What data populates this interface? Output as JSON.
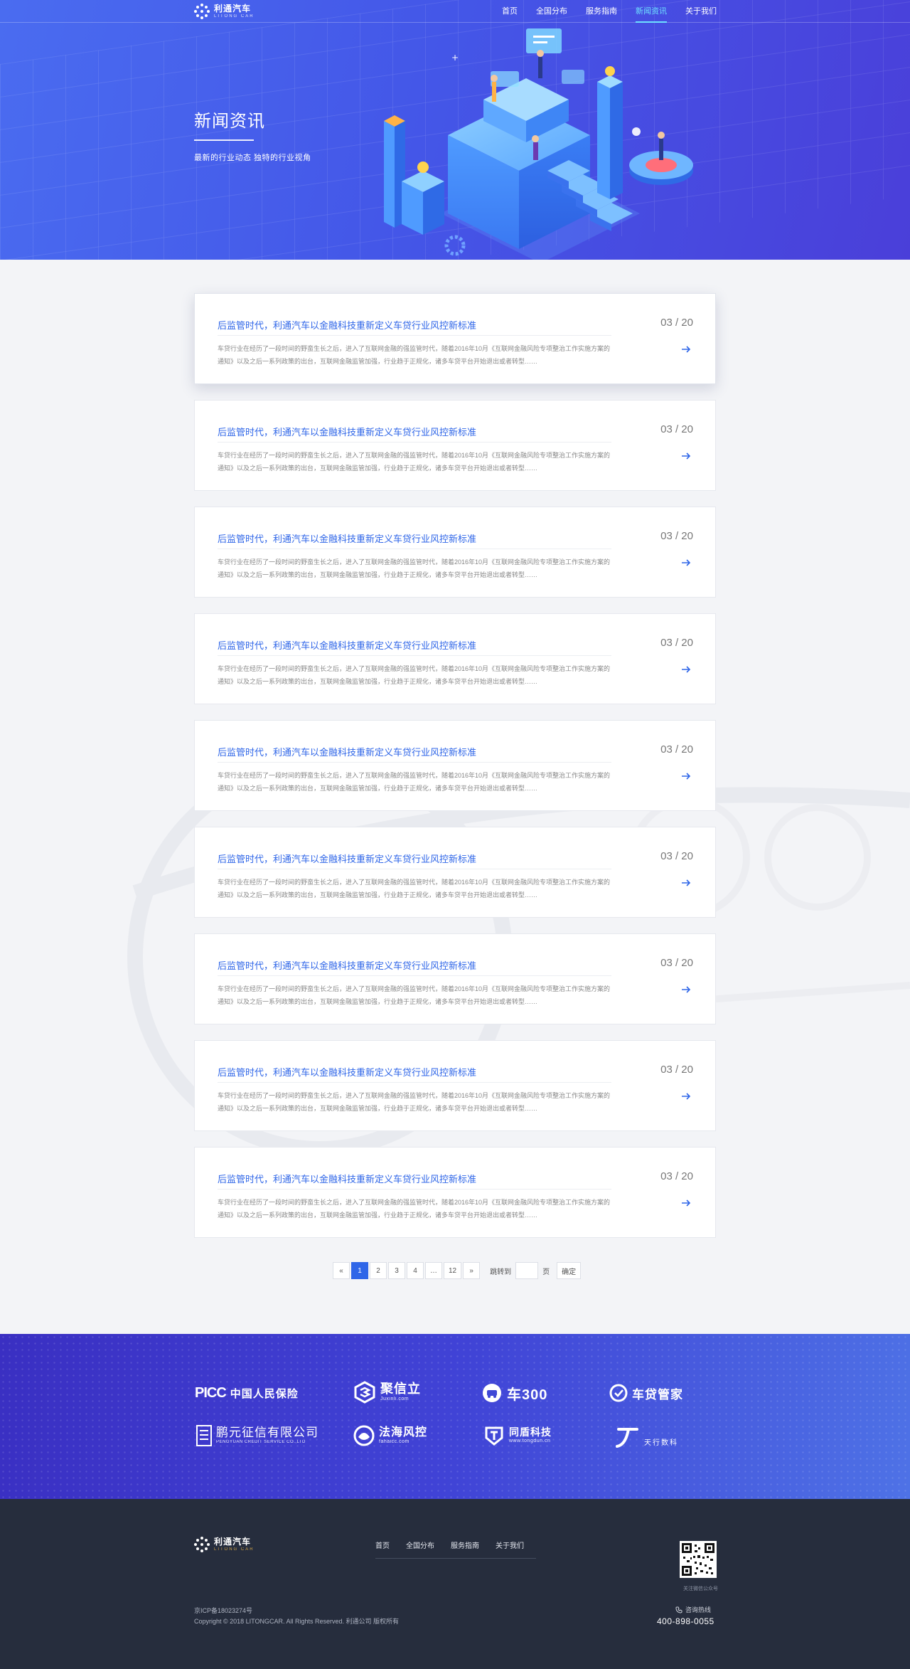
{
  "nav": {
    "logo_cn": "利通汽车",
    "logo_en": "LITONG CAR",
    "items": [
      {
        "label": "首页",
        "active": false
      },
      {
        "label": "全国分布",
        "active": false
      },
      {
        "label": "服务指南",
        "active": false
      },
      {
        "label": "新闻资讯",
        "active": true
      },
      {
        "label": "关于我们",
        "active": false
      }
    ]
  },
  "hero": {
    "title": "新闻资讯",
    "subtitle": "最新的行业动态  独特的行业视角"
  },
  "news": [
    {
      "title": "后监管时代，利通汽车以金融科技重新定义车贷行业风控新标准",
      "date": "03 / 20",
      "desc": "车贷行业在经历了一段时间的野蛮生长之后，进入了互联网金融的强监管时代，随着2016年10月《互联网金融风险专项整治工作实施方案的通知》以及之后一系列政策的出台，互联网金融监管加强，行业趋于正规化，诸多车贷平台开始退出或者转型……"
    },
    {
      "title": "后监管时代，利通汽车以金融科技重新定义车贷行业风控新标准",
      "date": "03 / 20",
      "desc": "车贷行业在经历了一段时间的野蛮生长之后，进入了互联网金融的强监管时代，随着2016年10月《互联网金融风险专项整治工作实施方案的通知》以及之后一系列政策的出台，互联网金融监管加强，行业趋于正规化，诸多车贷平台开始退出或者转型……"
    },
    {
      "title": "后监管时代，利通汽车以金融科技重新定义车贷行业风控新标准",
      "date": "03 / 20",
      "desc": "车贷行业在经历了一段时间的野蛮生长之后，进入了互联网金融的强监管时代，随着2016年10月《互联网金融风险专项整治工作实施方案的通知》以及之后一系列政策的出台，互联网金融监管加强，行业趋于正规化，诸多车贷平台开始退出或者转型……"
    },
    {
      "title": "后监管时代，利通汽车以金融科技重新定义车贷行业风控新标准",
      "date": "03 / 20",
      "desc": "车贷行业在经历了一段时间的野蛮生长之后，进入了互联网金融的强监管时代，随着2016年10月《互联网金融风险专项整治工作实施方案的通知》以及之后一系列政策的出台，互联网金融监管加强，行业趋于正规化，诸多车贷平台开始退出或者转型……"
    },
    {
      "title": "后监管时代，利通汽车以金融科技重新定义车贷行业风控新标准",
      "date": "03 / 20",
      "desc": "车贷行业在经历了一段时间的野蛮生长之后，进入了互联网金融的强监管时代，随着2016年10月《互联网金融风险专项整治工作实施方案的通知》以及之后一系列政策的出台，互联网金融监管加强，行业趋于正规化，诸多车贷平台开始退出或者转型……"
    },
    {
      "title": "后监管时代，利通汽车以金融科技重新定义车贷行业风控新标准",
      "date": "03 / 20",
      "desc": "车贷行业在经历了一段时间的野蛮生长之后，进入了互联网金融的强监管时代，随着2016年10月《互联网金融风险专项整治工作实施方案的通知》以及之后一系列政策的出台，互联网金融监管加强，行业趋于正规化，诸多车贷平台开始退出或者转型……"
    },
    {
      "title": "后监管时代，利通汽车以金融科技重新定义车贷行业风控新标准",
      "date": "03 / 20",
      "desc": "车贷行业在经历了一段时间的野蛮生长之后，进入了互联网金融的强监管时代，随着2016年10月《互联网金融风险专项整治工作实施方案的通知》以及之后一系列政策的出台，互联网金融监管加强，行业趋于正规化，诸多车贷平台开始退出或者转型……"
    },
    {
      "title": "后监管时代，利通汽车以金融科技重新定义车贷行业风控新标准",
      "date": "03 / 20",
      "desc": "车贷行业在经历了一段时间的野蛮生长之后，进入了互联网金融的强监管时代，随着2016年10月《互联网金融风险专项整治工作实施方案的通知》以及之后一系列政策的出台，互联网金融监管加强，行业趋于正规化，诸多车贷平台开始退出或者转型……"
    },
    {
      "title": "后监管时代，利通汽车以金融科技重新定义车贷行业风控新标准",
      "date": "03 / 20",
      "desc": "车贷行业在经历了一段时间的野蛮生长之后，进入了互联网金融的强监管时代，随着2016年10月《互联网金融风险专项整治工作实施方案的通知》以及之后一系列政策的出台，互联网金融监管加强，行业趋于正规化，诸多车贷平台开始退出或者转型……"
    }
  ],
  "pagination": {
    "prev": "«",
    "pages": [
      "1",
      "2",
      "3",
      "4",
      "…",
      "12"
    ],
    "current": "1",
    "next": "»",
    "jump_label": "跳转到",
    "page_unit": "页",
    "confirm": "确定"
  },
  "partners": {
    "picc_en": "PICC",
    "picc_cn": "中国人民保险",
    "juxinli_cn": "聚信立",
    "juxinli_url": "Juxinli.com",
    "che300": "车300",
    "chedai": "车贷管家",
    "pengyuan_cn": "鹏元征信有限公司",
    "pengyuan_en": "PENGYUAN CREDIT SERVICE CO.,LTD",
    "fahai_cn": "法海风控",
    "fahai_url": "fahaicc.com",
    "tongdun_cn": "同盾科技",
    "tongdun_url": "www.tongdun.cn",
    "tianxing": "天行数科"
  },
  "footer": {
    "logo_cn": "利通汽车",
    "logo_en": "LITONG CAR",
    "links": [
      "首页",
      "全国分布",
      "服务指南",
      "关于我们"
    ],
    "icp": "京ICP备18023274号",
    "copyright": "Copyright © 2018 LITONGCAR. All Rights Reserved. 利通公司 版权所有",
    "qr_caption": "关注微信公众号",
    "hotline_label": "咨询热线",
    "hotline": "400-898-0055"
  },
  "colors": {
    "accent": "#2f66e8",
    "nav_active": "#6ee0ff",
    "footer_bg": "#262d3d"
  }
}
